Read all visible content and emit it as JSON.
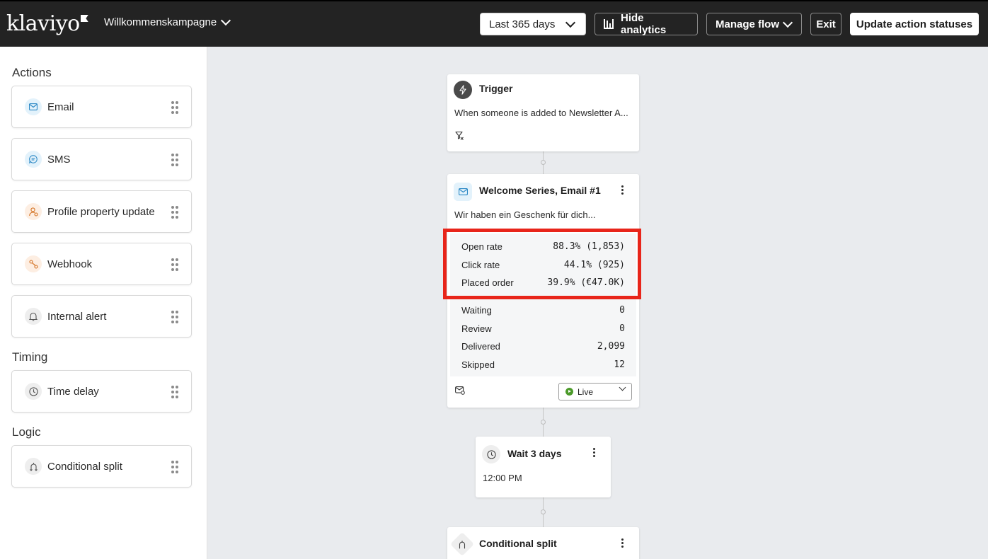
{
  "topbar": {
    "logo": "klaviyo",
    "flow_name": "Willkommenskampagne",
    "date_range": "Last 365 days",
    "hide_analytics": "Hide analytics",
    "manage_flow": "Manage flow",
    "exit": "Exit",
    "update_statuses": "Update action statuses"
  },
  "sidebar": {
    "actions_title": "Actions",
    "actions": [
      {
        "label": "Email",
        "icon": "mail-icon"
      },
      {
        "label": "SMS",
        "icon": "sms-icon"
      },
      {
        "label": "Profile property update",
        "icon": "profile-update-icon"
      },
      {
        "label": "Webhook",
        "icon": "webhook-icon"
      },
      {
        "label": "Internal alert",
        "icon": "bell-icon"
      }
    ],
    "timing_title": "Timing",
    "timing": [
      {
        "label": "Time delay",
        "icon": "clock-icon"
      }
    ],
    "logic_title": "Logic",
    "logic": [
      {
        "label": "Conditional split",
        "icon": "split-icon"
      }
    ]
  },
  "canvas": {
    "trigger": {
      "title": "Trigger",
      "text": "When someone is added to Newsletter A..."
    },
    "email": {
      "title": "Welcome Series, Email #1",
      "subject": "Wir haben ein Geschenk für dich...",
      "metrics": [
        {
          "label": "Open rate",
          "value": "88.3% (1,853)"
        },
        {
          "label": "Click rate",
          "value": "44.1% (925)"
        },
        {
          "label": "Placed order",
          "value": "39.9% (€47.0K)"
        }
      ],
      "statuses": [
        {
          "label": "Waiting",
          "value": "0"
        },
        {
          "label": "Review",
          "value": "0"
        },
        {
          "label": "Delivered",
          "value": "2,099"
        },
        {
          "label": "Skipped",
          "value": "12"
        }
      ],
      "status_select": "Live"
    },
    "wait": {
      "title": "Wait 3 days",
      "time": "12:00 PM"
    },
    "split": {
      "title": "Conditional split"
    }
  },
  "colors": {
    "topbar_bg": "#232323",
    "canvas_bg": "#e9ebee",
    "highlight": "#e8251a",
    "live_green": "#4c9a2a"
  }
}
